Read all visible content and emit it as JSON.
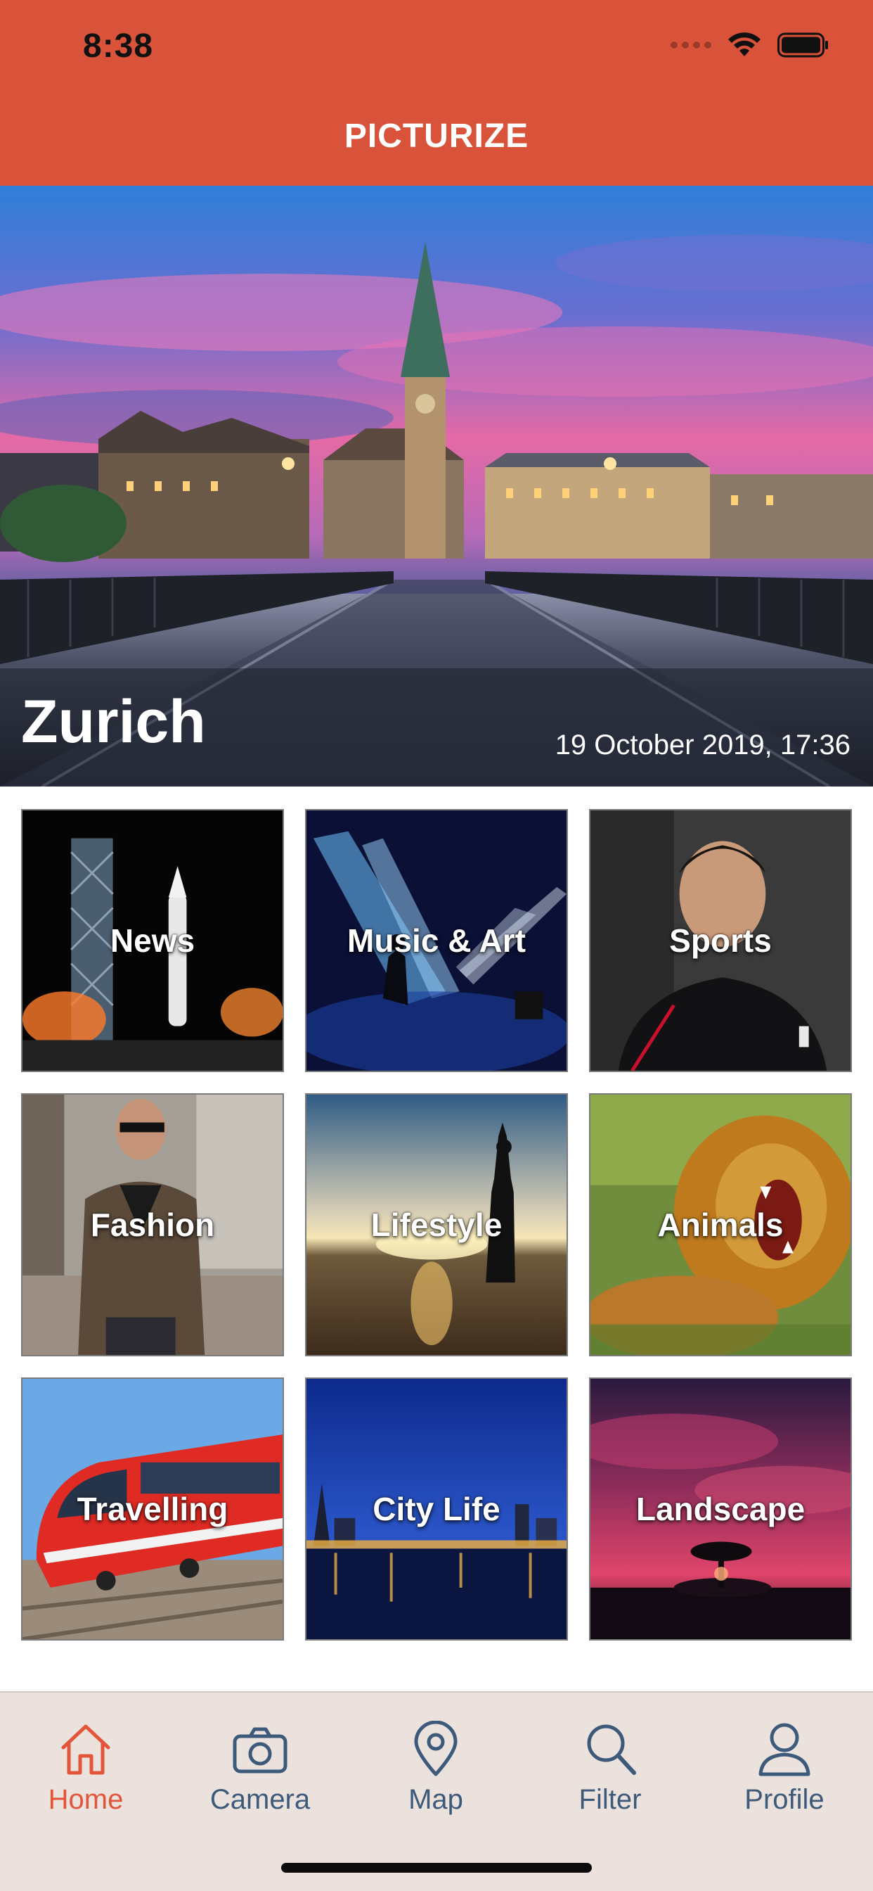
{
  "status_bar": {
    "time": "8:38"
  },
  "header": {
    "title": "PICTURIZE"
  },
  "hero": {
    "city": "Zurich",
    "datetime": "19 October 2019, 17:36"
  },
  "categories": [
    {
      "label": "News"
    },
    {
      "label": "Music & Art"
    },
    {
      "label": "Sports"
    },
    {
      "label": "Fashion"
    },
    {
      "label": "Lifestyle"
    },
    {
      "label": "Animals"
    },
    {
      "label": "Travelling"
    },
    {
      "label": "City Life"
    },
    {
      "label": "Landscape"
    }
  ],
  "tabbar": {
    "items": [
      {
        "label": "Home",
        "icon": "home-icon",
        "active": true
      },
      {
        "label": "Camera",
        "icon": "camera-icon",
        "active": false
      },
      {
        "label": "Map",
        "icon": "map-pin-icon",
        "active": false
      },
      {
        "label": "Filter",
        "icon": "search-icon",
        "active": false
      },
      {
        "label": "Profile",
        "icon": "person-icon",
        "active": false
      }
    ]
  },
  "colors": {
    "accent": "#d8533a",
    "tab_active": "#e2553b",
    "tab_inactive": "#3d5a7a",
    "tabbar_bg": "#ebe2dd"
  }
}
